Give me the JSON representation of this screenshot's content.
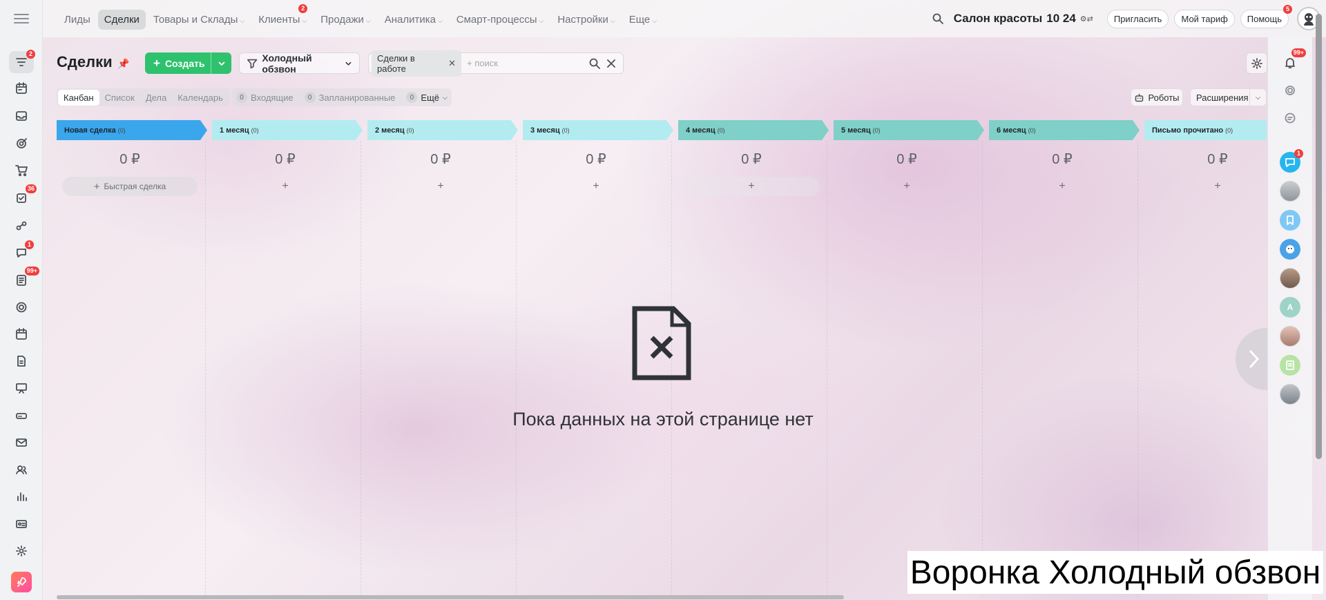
{
  "top_nav": {
    "items": [
      {
        "label": "Лиды"
      },
      {
        "label": "Сделки"
      },
      {
        "label": "Товары и Склады"
      },
      {
        "label": "Клиенты",
        "badge": "2"
      },
      {
        "label": "Продажи"
      },
      {
        "label": "Аналитика"
      },
      {
        "label": "Смарт-процессы"
      },
      {
        "label": "Настройки"
      },
      {
        "label": "Еще"
      }
    ],
    "company": "Салон красоты",
    "company_suffix": "10 24",
    "invite": "Пригласить",
    "tariff": "Мой тариф",
    "help": "Помощь",
    "help_badge": "5"
  },
  "left_bar": {
    "badges": {
      "crm": "2",
      "tasks": "36",
      "chat": "1",
      "feed": "99+"
    }
  },
  "header": {
    "title": "Сделки",
    "create": "Создать",
    "funnel": "Холодный обзвон",
    "filter_chip": "Сделки в работе",
    "search_placeholder": "+ поиск",
    "notif_badge": "99+"
  },
  "view": {
    "tabs": [
      "Канбан",
      "Список",
      "Дела",
      "Календарь"
    ],
    "counters": [
      {
        "num": "0",
        "label": "Входящие"
      },
      {
        "num": "0",
        "label": "Запланированные"
      },
      {
        "num": "0",
        "label": "Ещё"
      }
    ],
    "robots": "Роботы",
    "extensions": "Расширения"
  },
  "stages": [
    {
      "name": "Новая сделка",
      "count": "(0)",
      "sum": "0 ₽",
      "color": "#3aa6ec",
      "quick": "Быстрая сделка"
    },
    {
      "name": "1 месяц",
      "count": "(0)",
      "sum": "0 ₽",
      "color": "#b3ecf0"
    },
    {
      "name": "2 месяц",
      "count": "(0)",
      "sum": "0 ₽",
      "color": "#b3ecf0"
    },
    {
      "name": "3 месяц",
      "count": "(0)",
      "sum": "0 ₽",
      "color": "#b3ecf0"
    },
    {
      "name": "4 месяц",
      "count": "(0)",
      "sum": "0 ₽",
      "color": "#7fd0c8"
    },
    {
      "name": "5 месяц",
      "count": "(0)",
      "sum": "0 ₽",
      "color": "#7fd0c8"
    },
    {
      "name": "6 месяц",
      "count": "(0)",
      "sum": "0 ₽",
      "color": "#7fd0c8"
    },
    {
      "name": "Письмо прочитано",
      "count": "(0)",
      "sum": "0 ₽",
      "color": "#b3ecf0"
    }
  ],
  "empty": {
    "text": "Пока данных на этой странице нет"
  },
  "right_bar": {
    "chat_badge": "1",
    "avatar_letter": "A"
  },
  "caption": "Воронка Холодный обзвон"
}
